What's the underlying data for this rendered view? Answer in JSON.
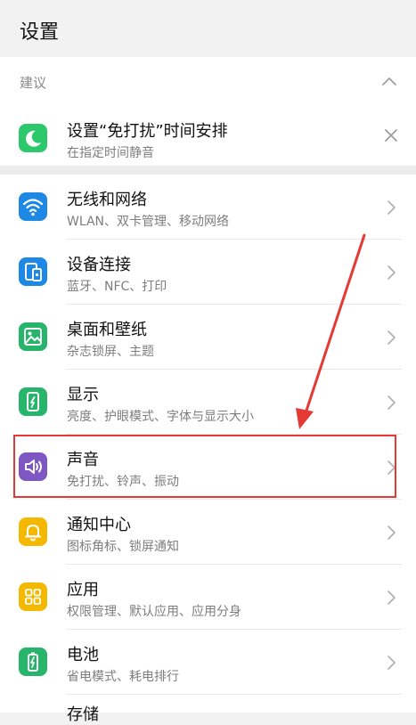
{
  "header": {
    "title": "设置"
  },
  "suggestion": {
    "section_label": "建议",
    "item": {
      "title": "设置“免打扰”时间安排",
      "subtitle": "在指定时间静音",
      "icon": "moon-icon",
      "color": "#2dc86b"
    }
  },
  "settings": [
    {
      "title": "无线和网络",
      "subtitle": "WLAN、双卡管理、移动网络",
      "icon": "wifi-icon",
      "color": "#1e88e5"
    },
    {
      "title": "设备连接",
      "subtitle": "蓝牙、NFC、打印",
      "icon": "devices-icon",
      "color": "#1e88e5"
    },
    {
      "title": "桌面和壁纸",
      "subtitle": "杂志锁屏、主题",
      "icon": "image-icon",
      "color": "#26b56b"
    },
    {
      "title": "显示",
      "subtitle": "亮度、护眼模式、字体与显示大小",
      "icon": "phone-brightness-icon",
      "color": "#26b56b"
    },
    {
      "title": "声音",
      "subtitle": "免打扰、铃声、振动",
      "icon": "speaker-icon",
      "color": "#7e57c2"
    },
    {
      "title": "通知中心",
      "subtitle": "图标角标、锁屏通知",
      "icon": "bell-icon",
      "color": "#f5b800"
    },
    {
      "title": "应用",
      "subtitle": "权限管理、默认应用、应用分身",
      "icon": "apps-grid-icon",
      "color": "#f5b800"
    },
    {
      "title": "电池",
      "subtitle": "省电模式、耗电排行",
      "icon": "battery-icon",
      "color": "#26b56b"
    }
  ],
  "next_item_partial": "存储",
  "annotation": {
    "highlight_color": "#e53935"
  }
}
